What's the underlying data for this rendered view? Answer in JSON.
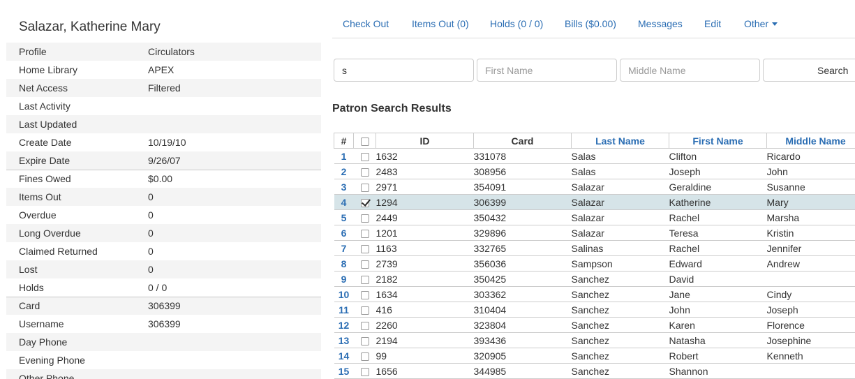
{
  "patron": {
    "name": "Salazar, Katherine Mary",
    "summary": [
      {
        "label": "Profile",
        "value": "Circulators"
      },
      {
        "label": "Home Library",
        "value": "APEX"
      },
      {
        "label": "Net Access",
        "value": "Filtered"
      },
      {
        "label": "Last Activity",
        "value": ""
      },
      {
        "label": "Last Updated",
        "value": ""
      },
      {
        "label": "Create Date",
        "value": "10/19/10"
      },
      {
        "label": "Expire Date",
        "value": "9/26/07"
      },
      {
        "label": "Fines Owed",
        "value": "$0.00"
      },
      {
        "label": "Items Out",
        "value": "0"
      },
      {
        "label": "Overdue",
        "value": "0"
      },
      {
        "label": "Long Overdue",
        "value": "0"
      },
      {
        "label": "Claimed Returned",
        "value": "0"
      },
      {
        "label": "Lost",
        "value": "0"
      },
      {
        "label": "Holds",
        "value": "0 / 0"
      },
      {
        "label": "Card",
        "value": "306399"
      },
      {
        "label": "Username",
        "value": "306399"
      },
      {
        "label": "Day Phone",
        "value": ""
      },
      {
        "label": "Evening Phone",
        "value": ""
      },
      {
        "label": "Other Phone",
        "value": ""
      }
    ]
  },
  "nav": {
    "check_out": "Check Out",
    "items_out": "Items Out (0)",
    "holds": "Holds (0 / 0)",
    "bills": "Bills ($0.00)",
    "messages": "Messages",
    "edit": "Edit",
    "other": "Other"
  },
  "search": {
    "last_name_value": "s",
    "first_name_placeholder": "First Name",
    "middle_name_placeholder": "Middle Name",
    "button": "Search"
  },
  "results": {
    "title": "Patron Search Results",
    "columns": {
      "index": "#",
      "id": "ID",
      "card": "Card",
      "last_name": "Last Name",
      "first_name": "First Name",
      "middle_name": "Middle Name"
    },
    "rows": [
      {
        "n": "1",
        "checked": false,
        "id": "1632",
        "card": "331078",
        "last": "Salas",
        "first": "Clifton",
        "middle": "Ricardo"
      },
      {
        "n": "2",
        "checked": false,
        "id": "2483",
        "card": "308956",
        "last": "Salas",
        "first": "Joseph",
        "middle": "John"
      },
      {
        "n": "3",
        "checked": false,
        "id": "2971",
        "card": "354091",
        "last": "Salazar",
        "first": "Geraldine",
        "middle": "Susanne"
      },
      {
        "n": "4",
        "checked": true,
        "id": "1294",
        "card": "306399",
        "last": "Salazar",
        "first": "Katherine",
        "middle": "Mary"
      },
      {
        "n": "5",
        "checked": false,
        "id": "2449",
        "card": "350432",
        "last": "Salazar",
        "first": "Rachel",
        "middle": "Marsha"
      },
      {
        "n": "6",
        "checked": false,
        "id": "1201",
        "card": "329896",
        "last": "Salazar",
        "first": "Teresa",
        "middle": "Kristin"
      },
      {
        "n": "7",
        "checked": false,
        "id": "1163",
        "card": "332765",
        "last": "Salinas",
        "first": "Rachel",
        "middle": "Jennifer"
      },
      {
        "n": "8",
        "checked": false,
        "id": "2739",
        "card": "356036",
        "last": "Sampson",
        "first": "Edward",
        "middle": "Andrew"
      },
      {
        "n": "9",
        "checked": false,
        "id": "2182",
        "card": "350425",
        "last": "Sanchez",
        "first": "David",
        "middle": ""
      },
      {
        "n": "10",
        "checked": false,
        "id": "1634",
        "card": "303362",
        "last": "Sanchez",
        "first": "Jane",
        "middle": "Cindy"
      },
      {
        "n": "11",
        "checked": false,
        "id": "416",
        "card": "310404",
        "last": "Sanchez",
        "first": "John",
        "middle": "Joseph"
      },
      {
        "n": "12",
        "checked": false,
        "id": "2260",
        "card": "323804",
        "last": "Sanchez",
        "first": "Karen",
        "middle": "Florence"
      },
      {
        "n": "13",
        "checked": false,
        "id": "2194",
        "card": "393436",
        "last": "Sanchez",
        "first": "Natasha",
        "middle": "Josephine"
      },
      {
        "n": "14",
        "checked": false,
        "id": "99",
        "card": "320905",
        "last": "Sanchez",
        "first": "Robert",
        "middle": "Kenneth"
      },
      {
        "n": "15",
        "checked": false,
        "id": "1656",
        "card": "344985",
        "last": "Sanchez",
        "first": "Shannon",
        "middle": ""
      }
    ]
  }
}
